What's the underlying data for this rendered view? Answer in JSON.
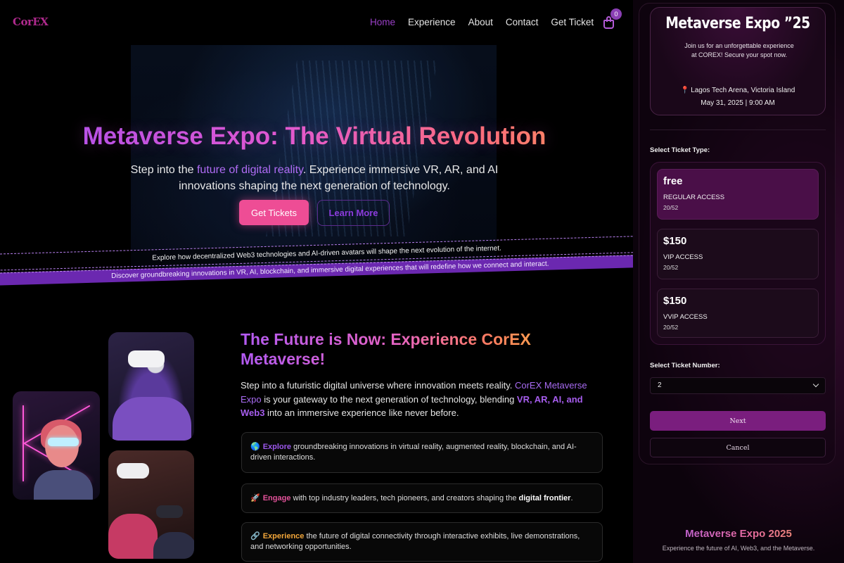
{
  "nav": {
    "logo": "CorEX",
    "items": [
      {
        "label": "Home",
        "active": true
      },
      {
        "label": "Experience"
      },
      {
        "label": "About"
      },
      {
        "label": "Contact"
      },
      {
        "label": "Get Ticket"
      }
    ],
    "cart_count": "0"
  },
  "hero": {
    "title": "Metaverse Expo: The Virtual Revolution",
    "subtitle_pre": "Step into the ",
    "subtitle_highlight": "future of digital reality",
    "subtitle_post": ". Experience immersive VR, AR, and AI innovations shaping the next generation of technology.",
    "btn_tickets": "Get Tickets",
    "btn_learn": "Learn More"
  },
  "marquee": {
    "line1": "Explore how decentralized Web3 technologies and AI-driven avatars will shape the next evolution of the internet.",
    "line2": "Discover groundbreaking innovations in VR, AI, blockchain, and immersive digital experiences that will redefine how we connect and interact."
  },
  "feature": {
    "title": "The Future is Now: Experience CorEX Metaverse!",
    "desc_1": "Step into a futuristic digital universe where innovation meets reality. ",
    "desc_brand": "CorEX Metaverse Expo",
    "desc_2": " is your gateway to the next generation of technology, blending ",
    "desc_tech": "VR, AR, AI, and Web3",
    "desc_3": " into an immersive experience like never before.",
    "cards": [
      {
        "icon": "🌎",
        "keyword": "Explore",
        "text": " groundbreaking innovations in virtual reality, augmented reality, blockchain, and AI-driven interactions."
      },
      {
        "icon": "🚀",
        "keyword": "Engage",
        "text": " with top industry leaders, tech pioneers, and creators shaping the ",
        "strong": "digital frontier",
        "tail": "."
      },
      {
        "icon": "🔗",
        "keyword": "Experience",
        "text": " the future of digital connectivity through interactive exhibits, live demonstrations, and networking opportunities."
      }
    ]
  },
  "event": {
    "title": "Metaverse Expo ”25",
    "description": "Join us for an unforgettable experience at COREX! Secure your spot now.",
    "location": "Lagos Tech Arena, Victoria Island",
    "date": "May 31, 2025 | 9:00 AM"
  },
  "booking": {
    "ticket_type_label": "Select Ticket Type:",
    "tickets": [
      {
        "price": "free",
        "name": "REGULAR ACCESS",
        "count": "20/52",
        "selected": true
      },
      {
        "price": "$150",
        "name": "VIP ACCESS",
        "count": "20/52"
      },
      {
        "price": "$150",
        "name": "VVIP ACCESS",
        "count": "20/52"
      }
    ],
    "ticket_number_label": "Select Ticket Number:",
    "ticket_number_value": "2",
    "btn_next": "Next",
    "btn_cancel": "Cancel"
  },
  "footer": {
    "title": "Metaverse Expo 2025",
    "subtitle": "Experience the future of AI, Web3, and the Metaverse."
  },
  "colors": {
    "accent_purple": "#9b57ea",
    "accent_pink": "#ee4d95",
    "accent_orange": "#f2a63a",
    "panel_bg": "#1a0619"
  },
  "icons": [
    "cart-icon",
    "location-pin-icon",
    "chevron-down-icon",
    "globe-icon",
    "rocket-icon",
    "link-icon"
  ]
}
